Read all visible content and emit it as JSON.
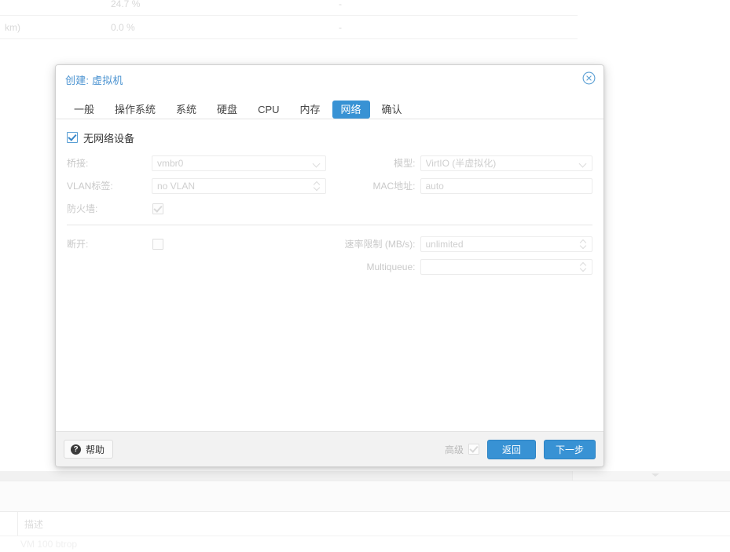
{
  "background": {
    "top_table": {
      "rows": [
        {
          "c1": "",
          "c2": "24.7 %",
          "c3": "-"
        },
        {
          "c1": "km)",
          "c2": "0.0 %",
          "c3": "-"
        }
      ]
    },
    "bottom": {
      "description_header": "描述",
      "last_row": "VM 100  btrop"
    }
  },
  "dialog": {
    "title": "创建: 虚拟机",
    "close_icon": "close-circle-icon",
    "tabs": [
      {
        "label": "一般",
        "active": false
      },
      {
        "label": "操作系统",
        "active": false
      },
      {
        "label": "系统",
        "active": false
      },
      {
        "label": "硬盘",
        "active": false
      },
      {
        "label": "CPU",
        "active": false
      },
      {
        "label": "内存",
        "active": false
      },
      {
        "label": "网络",
        "active": true
      },
      {
        "label": "确认",
        "active": false
      }
    ],
    "active_tab_color": "#3892d4",
    "form": {
      "no_network_device": {
        "label": "无网络设备",
        "checked": true
      },
      "left": [
        {
          "label": "桥接:",
          "type": "combo",
          "value": "vmbr0",
          "disabled": true
        },
        {
          "label": "VLAN标签:",
          "type": "spinner",
          "value": "no VLAN",
          "disabled": true
        },
        {
          "label": "防火墙:",
          "type": "checkbox",
          "checked": true,
          "disabled": true
        }
      ],
      "right": [
        {
          "label": "模型:",
          "type": "combo",
          "value": "VirtIO (半虚拟化)",
          "disabled": true
        },
        {
          "label": "MAC地址:",
          "type": "text",
          "value": "auto",
          "disabled": true
        }
      ],
      "advanced_left": [
        {
          "label": "断开:",
          "type": "checkbox",
          "checked": false,
          "disabled": true
        }
      ],
      "advanced_right": [
        {
          "label": "速率限制 (MB/s):",
          "type": "spinner",
          "value": "unlimited",
          "disabled": true
        },
        {
          "label": "Multiqueue:",
          "type": "spinner",
          "value": "",
          "disabled": true
        }
      ]
    },
    "footer": {
      "help_label": "帮助",
      "help_icon": "question-mark-icon",
      "advanced_label": "高级",
      "advanced_checked": true,
      "back_label": "返回",
      "next_label": "下一步"
    }
  }
}
